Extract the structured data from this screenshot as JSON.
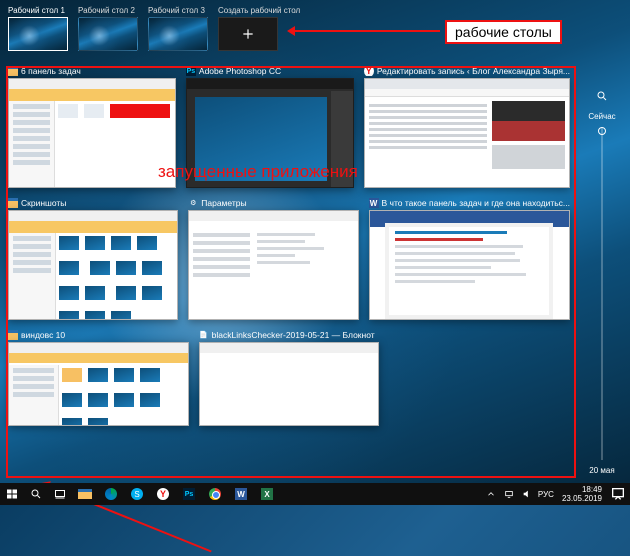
{
  "annotations": {
    "desktops_label": "рабочие столы",
    "running_label": "запущенные приложения"
  },
  "desktops": {
    "items": [
      {
        "label": "Рабочий стол 1"
      },
      {
        "label": "Рабочий стол 2"
      },
      {
        "label": "Рабочий стол 3"
      }
    ],
    "new_label": "Создать рабочий стол"
  },
  "timeline": {
    "now_label": "Сейчас",
    "date_label": "20 мая"
  },
  "tasks": {
    "row1": [
      {
        "title": "6 панель задач",
        "icon": "explorer"
      },
      {
        "title": "Adobe Photoshop CC",
        "icon": "ps"
      },
      {
        "title": "Редактировать запись ‹ Блог Александра Зыря...",
        "icon": "yandex"
      }
    ],
    "row2": [
      {
        "title": "Скриншоты",
        "icon": "explorer"
      },
      {
        "title": "Параметры",
        "icon": "settings"
      },
      {
        "title": "В что такое панель задач и где она находитьс...",
        "icon": "word"
      }
    ],
    "row3": [
      {
        "title": "виндовс 10",
        "icon": "explorer"
      },
      {
        "title": "blackLinksChecker-2019-05-21 — Блокнот",
        "icon": "notepad"
      }
    ]
  },
  "taskbar": {
    "lang": "РУС",
    "time": "18:49",
    "date": "23.05.2019"
  }
}
